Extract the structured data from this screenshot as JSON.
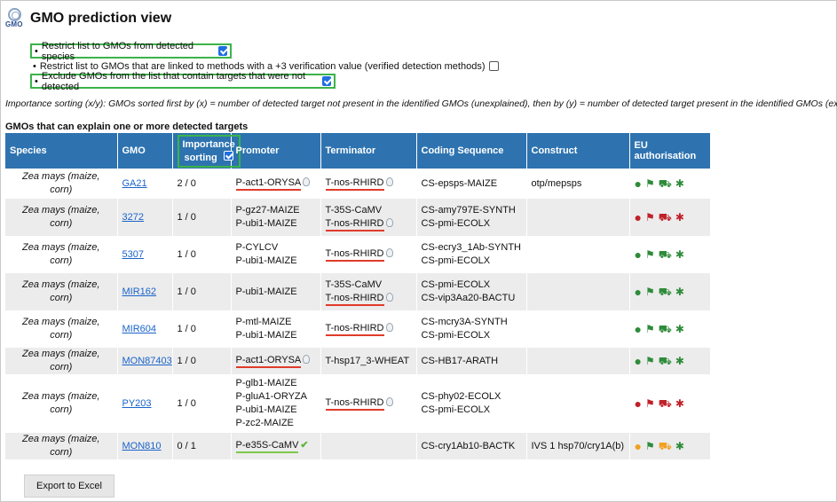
{
  "page": {
    "title": "GMO prediction view",
    "logo_text": "GMO"
  },
  "options": [
    {
      "label": "Restrict list to GMOs from detected species",
      "checked": true,
      "highlight": true
    },
    {
      "label": "Restrict list to GMOs that are linked to methods with a +3 verification value (verified detection methods)",
      "checked": false,
      "highlight": false
    },
    {
      "label": "Exclude GMOs from the list that contain targets that were not detected",
      "checked": true,
      "highlight": true
    }
  ],
  "note": "Importance sorting (x/y): GMOs sorted first by (x) = number of detected target not present in the identified GMOs (unexplained), then by (y) = number of detected target present in the identified GMOs (explained)",
  "section_title": "GMOs that can explain one or more detected targets",
  "table": {
    "headers": {
      "species": "Species",
      "gmo": "GMO",
      "importance_1": "Importance",
      "importance_2": "sorting",
      "promoter": "Promoter",
      "terminator": "Terminator",
      "coding": "Coding Sequence",
      "construct": "Construct",
      "eu": "EU authorisation"
    },
    "rows": [
      {
        "species": "Zea mays (maize, corn)",
        "gmo": "GA21",
        "importance": "2 / 0",
        "promoter": [
          {
            "t": "P-act1-ORYSA",
            "mark": "red",
            "icon": "bulb"
          }
        ],
        "terminator": [
          {
            "t": "T-nos-RHIRD",
            "mark": "red",
            "icon": "bulb"
          }
        ],
        "coding": [
          "CS-epsps-MAIZE"
        ],
        "construct": "otp/mepsps",
        "eu": [
          "green",
          "green",
          "green",
          "green"
        ]
      },
      {
        "species": "Zea mays (maize, corn)",
        "gmo": "3272",
        "importance": "1 / 0",
        "promoter": [
          {
            "t": "P-gz27-MAIZE"
          },
          {
            "t": "P-ubi1-MAIZE"
          }
        ],
        "terminator": [
          {
            "t": "T-35S-CaMV"
          },
          {
            "t": "T-nos-RHIRD",
            "mark": "red",
            "icon": "bulb"
          }
        ],
        "coding": [
          "CS-amy797E-SYNTH",
          "CS-pmi-ECOLX"
        ],
        "construct": "",
        "eu": [
          "red",
          "red",
          "red",
          "red"
        ]
      },
      {
        "species": "Zea mays (maize, corn)",
        "gmo": "5307",
        "importance": "1 / 0",
        "promoter": [
          {
            "t": "P-CYLCV"
          },
          {
            "t": "P-ubi1-MAIZE"
          }
        ],
        "terminator": [
          {
            "t": "T-nos-RHIRD",
            "mark": "red",
            "icon": "bulb"
          }
        ],
        "coding": [
          "CS-ecry3_1Ab-SYNTH",
          "CS-pmi-ECOLX"
        ],
        "construct": "",
        "eu": [
          "green",
          "green",
          "green",
          "green"
        ]
      },
      {
        "species": "Zea mays (maize, corn)",
        "gmo": "MIR162",
        "importance": "1 / 0",
        "promoter": [
          {
            "t": "P-ubi1-MAIZE"
          }
        ],
        "terminator": [
          {
            "t": "T-35S-CaMV"
          },
          {
            "t": "T-nos-RHIRD",
            "mark": "red",
            "icon": "bulb"
          }
        ],
        "coding": [
          "CS-pmi-ECOLX",
          "CS-vip3Aa20-BACTU"
        ],
        "construct": "",
        "eu": [
          "green",
          "green",
          "green",
          "green"
        ]
      },
      {
        "species": "Zea mays (maize, corn)",
        "gmo": "MIR604",
        "importance": "1 / 0",
        "promoter": [
          {
            "t": "P-mtl-MAIZE"
          },
          {
            "t": "P-ubi1-MAIZE"
          }
        ],
        "terminator": [
          {
            "t": "T-nos-RHIRD",
            "mark": "red",
            "icon": "bulb"
          }
        ],
        "coding": [
          "CS-mcry3A-SYNTH",
          "CS-pmi-ECOLX"
        ],
        "construct": "",
        "eu": [
          "green",
          "green",
          "green",
          "green"
        ]
      },
      {
        "species": "Zea mays (maize, corn)",
        "gmo": "MON87403",
        "importance": "1 / 0",
        "promoter": [
          {
            "t": "P-act1-ORYSA",
            "mark": "red",
            "icon": "bulb"
          }
        ],
        "terminator": [
          {
            "t": "T-hsp17_3-WHEAT"
          }
        ],
        "coding": [
          "CS-HB17-ARATH"
        ],
        "construct": "",
        "eu": [
          "green",
          "green",
          "green",
          "green"
        ]
      },
      {
        "species": "Zea mays (maize, corn)",
        "gmo": "PY203",
        "importance": "1 / 0",
        "promoter": [
          {
            "t": "P-glb1-MAIZE"
          },
          {
            "t": "P-gluA1-ORYZA"
          },
          {
            "t": "P-ubi1-MAIZE"
          },
          {
            "t": "P-zc2-MAIZE"
          }
        ],
        "terminator": [
          {
            "t": "T-nos-RHIRD",
            "mark": "red",
            "icon": "bulb"
          }
        ],
        "coding": [
          "CS-phy02-ECOLX",
          "CS-pmi-ECOLX"
        ],
        "construct": "",
        "eu": [
          "red",
          "red",
          "red",
          "red"
        ]
      },
      {
        "species": "Zea mays (maize, corn)",
        "gmo": "MON810",
        "importance": "0 / 1",
        "promoter": [
          {
            "t": "P-e35S-CaMV",
            "mark": "green",
            "icon": "check"
          }
        ],
        "terminator": [],
        "coding": [
          "CS-cry1Ab10-BACTK"
        ],
        "construct": "IVS 1 hsp70/cry1A(b)",
        "eu": [
          "orange",
          "green",
          "orange",
          "green"
        ]
      }
    ]
  },
  "colors": {
    "header_bg": "#2e73b0",
    "green": "#2e8b3a",
    "red": "#c0202a",
    "orange": "#f0a020",
    "highlight": "#3bb34a"
  },
  "eu_icons": [
    "food-icon",
    "feed-icon",
    "cultivation-icon",
    "import-processing-icon"
  ],
  "export_button": "Export to Excel"
}
